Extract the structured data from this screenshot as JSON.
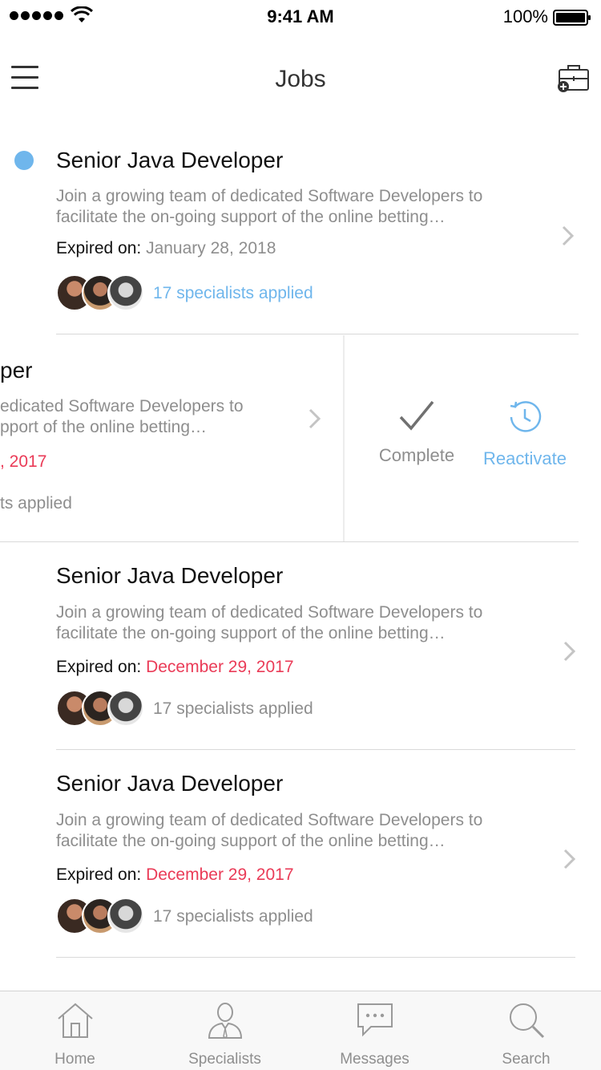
{
  "status_bar": {
    "time": "9:41 AM",
    "battery": "100%"
  },
  "nav": {
    "title": "Jobs"
  },
  "jobs": [
    {
      "title": "Senior Java Developer",
      "description_line1": "Join a growing team of dedicated Software Developers to",
      "description_line2": "facilitate the on-going support of the online betting…",
      "expiry_label": "Expired on:",
      "expiry_date": "January 28, 2018",
      "applied": "17 specialists applied",
      "unread": true
    },
    {
      "title_partial": "per",
      "description_line1_partial": "edicated Software Developers to",
      "description_line2_partial": "pport of the online betting…",
      "expiry_date_partial": ", 2017",
      "applied_partial": "ts applied",
      "actions": {
        "complete": "Complete",
        "reactivate": "Reactivate"
      }
    },
    {
      "title": "Senior Java Developer",
      "description_line1": "Join a growing team of dedicated Software Developers to",
      "description_line2": "facilitate the on-going support of the online betting…",
      "expiry_label": "Expired on:",
      "expiry_date": "December 29, 2017",
      "applied": "17 specialists applied"
    },
    {
      "title": "Senior Java Developer",
      "description_line1": "Join a growing team of dedicated Software Developers to",
      "description_line2": "facilitate the on-going support of the online betting…",
      "expiry_label": "Expired on:",
      "expiry_date": "December 29, 2017",
      "applied": "17 specialists applied"
    }
  ],
  "tabs": [
    {
      "label": "Home",
      "icon": "home-icon"
    },
    {
      "label": "Specialists",
      "icon": "specialist-icon"
    },
    {
      "label": "Messages",
      "icon": "chat-icon"
    },
    {
      "label": "Search",
      "icon": "search-icon"
    }
  ],
  "colors": {
    "accent_blue": "#6fb6ec",
    "expired_red": "#ea3b57",
    "secondary_text": "#8e8e8e",
    "divider": "#d9d9d9"
  }
}
